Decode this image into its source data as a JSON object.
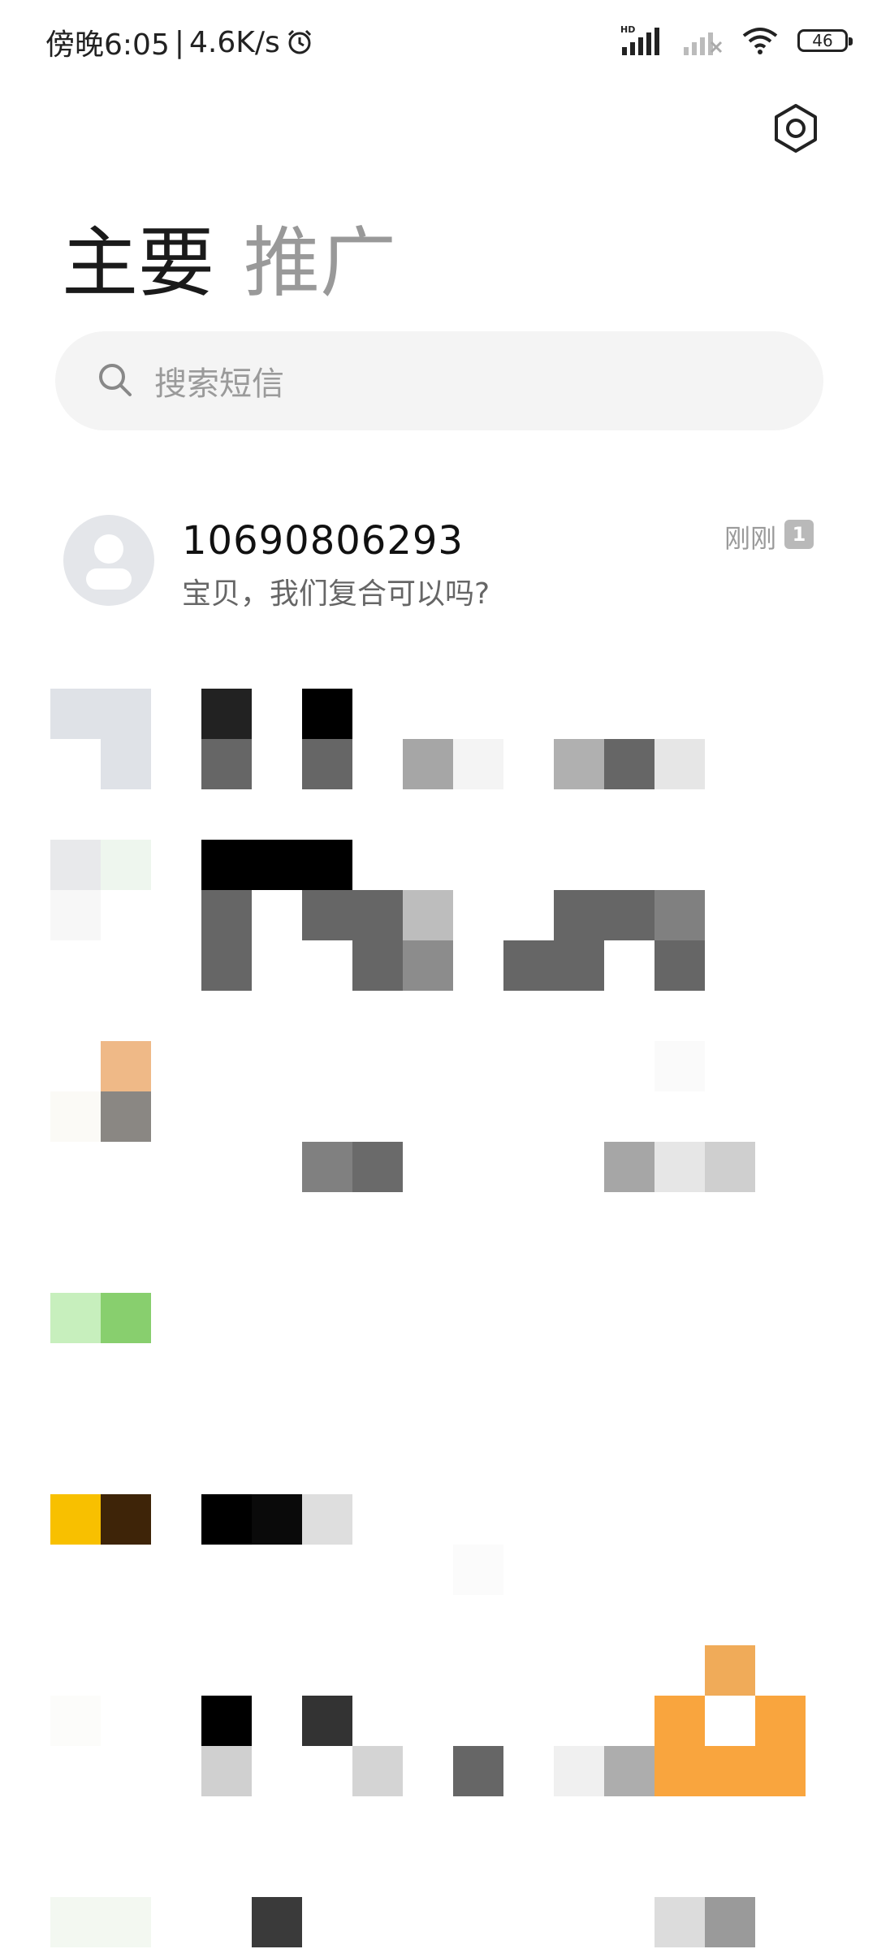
{
  "status_bar": {
    "time": "傍晚6:05",
    "network_speed": "4.6K/s",
    "battery": "46",
    "hd_label": "HD"
  },
  "tabs": [
    {
      "label": "主要"
    },
    {
      "label": "推广"
    }
  ],
  "search": {
    "placeholder": "搜索短信"
  },
  "conversations": [
    {
      "sender": "10690806293",
      "preview": "宝贝，我们复合可以吗?",
      "time": "刚刚",
      "unread": "1"
    }
  ],
  "colors": {
    "accent_orange": "#f9a53e",
    "yellow": "#f8c000",
    "green": "#88cf6e",
    "search_bg": "#f4f4f4"
  }
}
